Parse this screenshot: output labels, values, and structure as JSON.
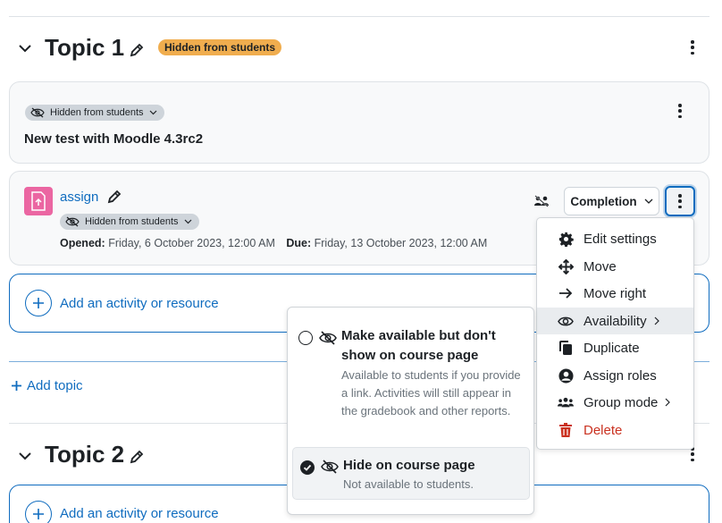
{
  "topic1": {
    "title": "Topic 1",
    "badge": "Hidden from students"
  },
  "label_card": {
    "visibility": "Hidden from students",
    "text": "New test with Moodle 4.3rc2"
  },
  "assign_card": {
    "name": "assign",
    "visibility": "Hidden from students",
    "opened_label": "Opened:",
    "opened_value": "Friday, 6 October 2023, 12:00 AM",
    "due_label": "Due:",
    "due_value": "Friday, 13 October 2023, 12:00 AM",
    "completion_label": "Completion"
  },
  "add_activity_label": "Add an activity or resource",
  "add_topic_label": "Add topic",
  "topic2": {
    "title": "Topic 2"
  },
  "action_menu": {
    "items": [
      {
        "label": "Edit settings",
        "icon": "gear-icon"
      },
      {
        "label": "Move",
        "icon": "move-arrows-icon"
      },
      {
        "label": "Move right",
        "icon": "arrow-right-icon"
      },
      {
        "label": "Availability",
        "icon": "eye-icon",
        "submenu": true
      },
      {
        "label": "Duplicate",
        "icon": "copy-icon"
      },
      {
        "label": "Assign roles",
        "icon": "user-circle-icon"
      },
      {
        "label": "Group mode",
        "icon": "users-icon",
        "submenu": true
      },
      {
        "label": "Delete",
        "icon": "trash-icon"
      }
    ]
  },
  "availability_menu": {
    "option1_title": "Make available but don't show on course page",
    "option1_desc": "Available to students if you provide a link. Activities will still appear in the gradebook and other reports.",
    "option2_title": "Hide on course page",
    "option2_desc": "Not available to students."
  },
  "colors": {
    "accent": "#0f6cbf",
    "warning": "#f0ad4e",
    "danger": "#ca3120",
    "assign_icon_bg": "#eb66a2"
  }
}
